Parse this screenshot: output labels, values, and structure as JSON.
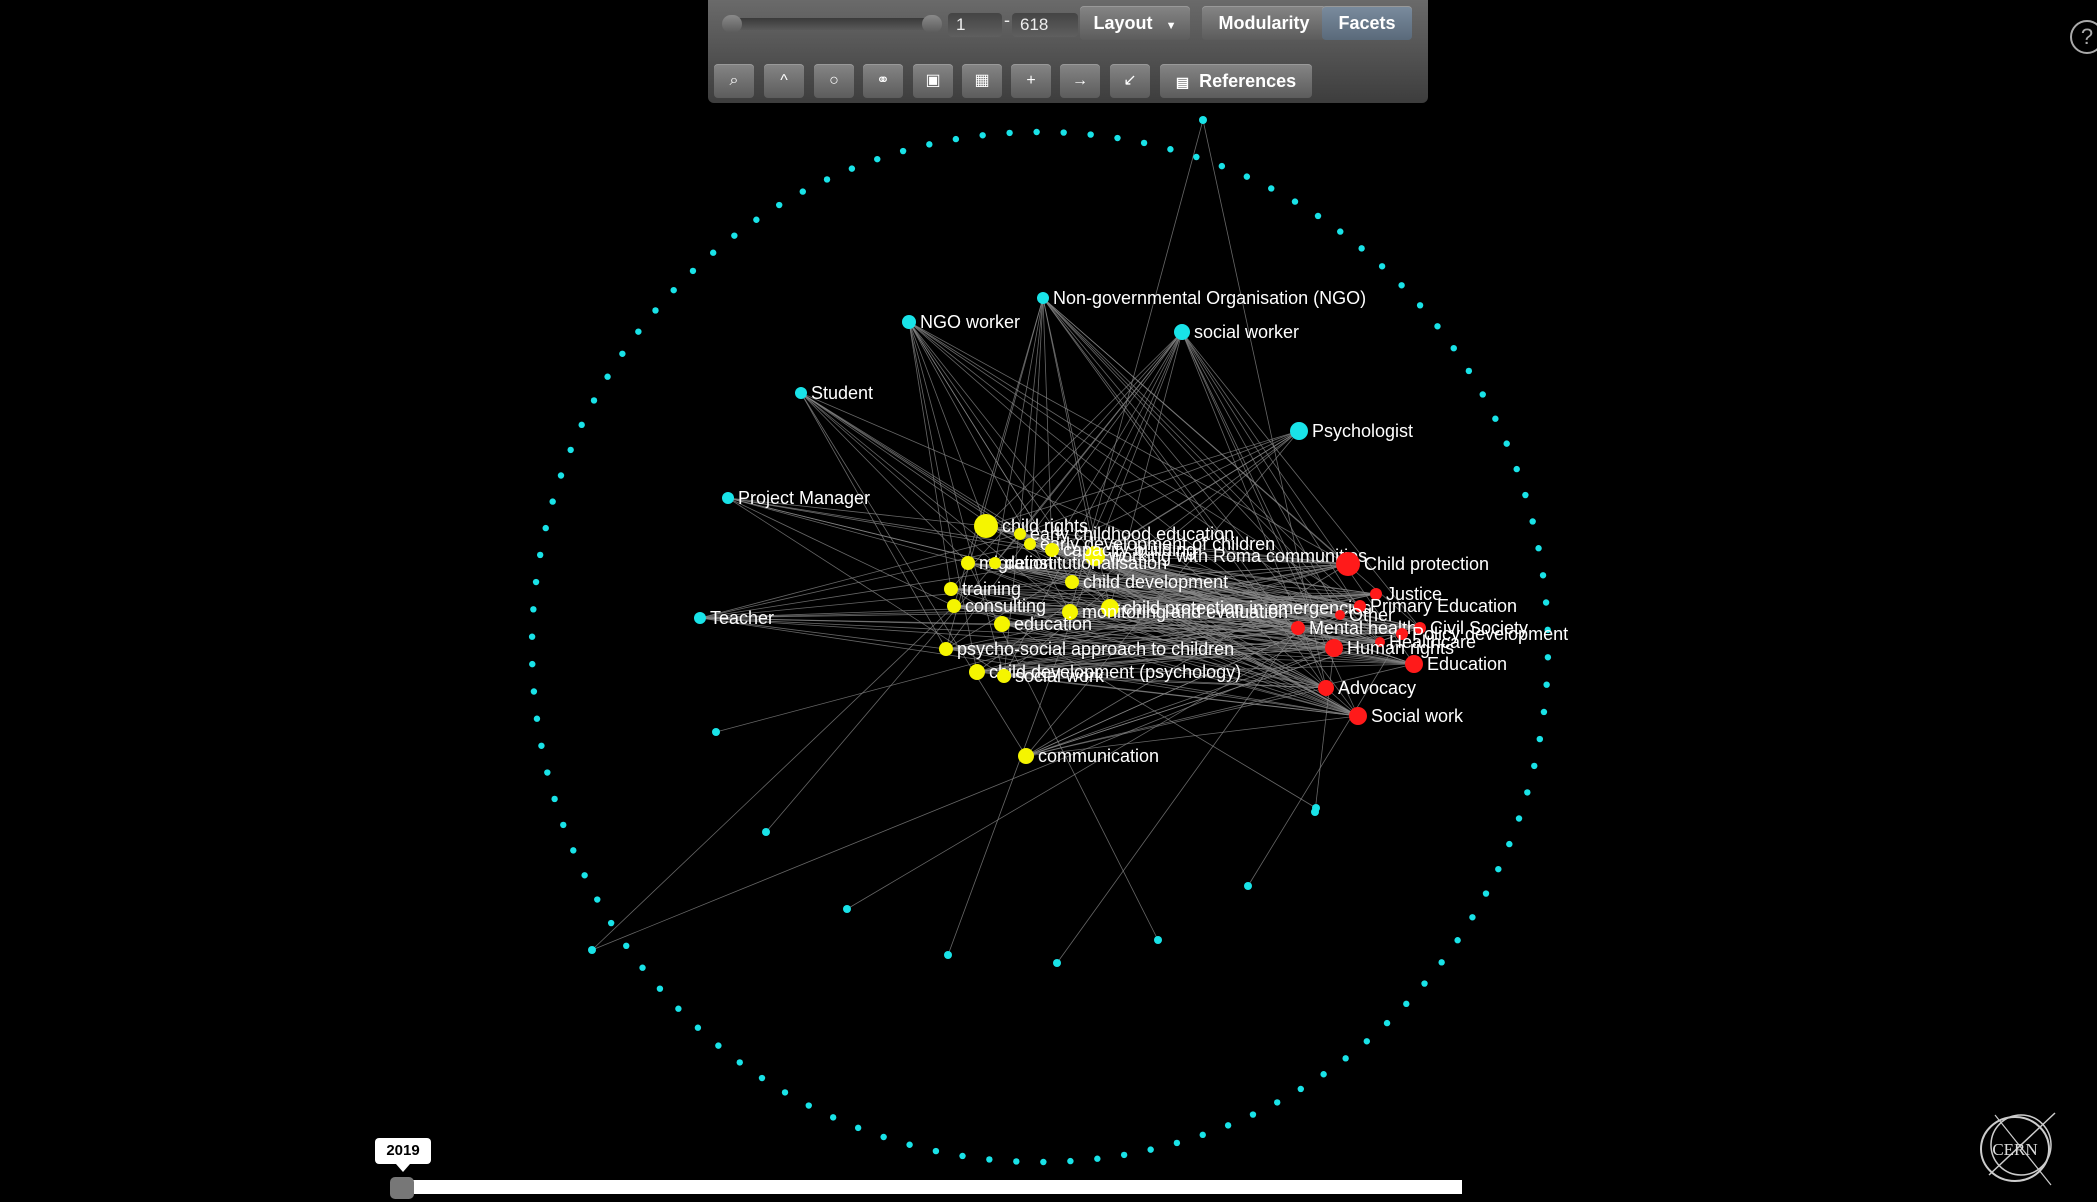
{
  "toolbar": {
    "range_start": "1",
    "range_end": "618",
    "range_separator": "-",
    "layout_label": "Layout",
    "modularity_label": "Modularity",
    "facets_label": "Facets",
    "references_label": "References",
    "icons": [
      "search-icon",
      "collapse-icon",
      "circle-icon",
      "link-icon",
      "image-icon",
      "table-icon",
      "add-icon",
      "arrow-right-icon",
      "shrink-icon"
    ]
  },
  "help_label": "?",
  "timeline": {
    "year": "2019"
  },
  "logo": {
    "text": "CERN"
  },
  "colors": {
    "role": "#19e3e8",
    "topic": "#f5f500",
    "field": "#ff1a1a",
    "edge": "#8a8a8a"
  },
  "nodes": [
    {
      "label": "Non-governmental Organisation (NGO)",
      "group": "role"
    },
    {
      "label": "NGO worker",
      "group": "role"
    },
    {
      "label": "social worker",
      "group": "role"
    },
    {
      "label": "Student",
      "group": "role"
    },
    {
      "label": "Psychologist",
      "group": "role"
    },
    {
      "label": "Project Manager",
      "group": "role"
    },
    {
      "label": "Teacher",
      "group": "role"
    },
    {
      "label": "child rights",
      "group": "topic"
    },
    {
      "label": "early childhood education",
      "group": "topic"
    },
    {
      "label": "early development of children",
      "group": "topic"
    },
    {
      "label": "working with Roma communities",
      "group": "topic"
    },
    {
      "label": "capacity building",
      "group": "topic"
    },
    {
      "label": "migration",
      "group": "topic"
    },
    {
      "label": "deinstitutionalisation",
      "group": "topic"
    },
    {
      "label": "training",
      "group": "topic"
    },
    {
      "label": "child development",
      "group": "topic"
    },
    {
      "label": "consulting",
      "group": "topic"
    },
    {
      "label": "child protection in emergencies",
      "group": "topic"
    },
    {
      "label": "monitoring and evaluation",
      "group": "topic"
    },
    {
      "label": "education",
      "group": "topic"
    },
    {
      "label": "psycho-social approach to children",
      "group": "topic"
    },
    {
      "label": "child development (psychology)",
      "group": "topic"
    },
    {
      "label": "social work",
      "group": "topic"
    },
    {
      "label": "communication",
      "group": "topic"
    },
    {
      "label": "Child protection",
      "group": "field"
    },
    {
      "label": "Justice",
      "group": "field"
    },
    {
      "label": "Primary Education",
      "group": "field"
    },
    {
      "label": "Other",
      "group": "field"
    },
    {
      "label": "Mental health",
      "group": "field"
    },
    {
      "label": "Civil Society",
      "group": "field"
    },
    {
      "label": "Policy development",
      "group": "field"
    },
    {
      "label": "Healthcare",
      "group": "field"
    },
    {
      "label": "Human rights",
      "group": "field"
    },
    {
      "label": "Education",
      "group": "field"
    },
    {
      "label": "Advocacy",
      "group": "field"
    },
    {
      "label": "Social work",
      "group": "field"
    }
  ]
}
